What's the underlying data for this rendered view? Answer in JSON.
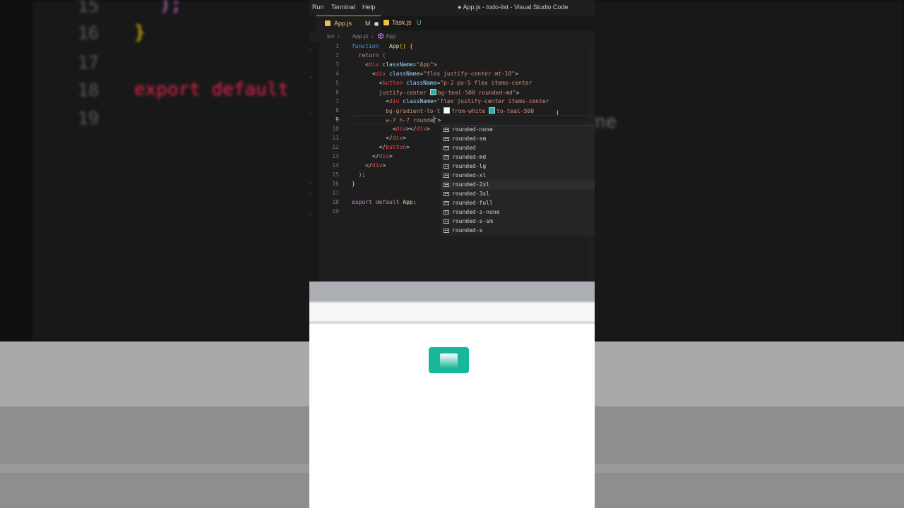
{
  "window": {
    "title": "● App.js - todo-list - Visual Studio Code"
  },
  "menu": [
    "Run",
    "Terminal",
    "Help"
  ],
  "tabs": [
    {
      "label": "App.js",
      "badge": "M",
      "dirty": true,
      "active": true
    },
    {
      "label": "Task.js",
      "badge": "U",
      "dirty": false,
      "active": false
    }
  ],
  "breadcrumb": {
    "folder": "src",
    "sep": "›",
    "file": "App.js",
    "symbol": "App"
  },
  "editor": {
    "line_numbers": [
      "1",
      "2",
      "3",
      "4",
      "5",
      "6",
      "7",
      "8",
      "9",
      "10",
      "11",
      "12",
      "13",
      "14",
      "15",
      "16",
      "17",
      "18",
      "19"
    ],
    "current_line": "9",
    "swatch_colors": {
      "white": "#ffffff",
      "teal500": "#14b8a6"
    }
  },
  "suggestions": {
    "items": [
      "rounded-none",
      "rounded-sm",
      "rounded",
      "rounded-md",
      "rounded-lg",
      "rounded-xl",
      "rounded-2xl",
      "rounded-3xl",
      "rounded-full",
      "rounded-s-none",
      "rounded-s-sm",
      "rounded-s"
    ],
    "selected_index": 6
  },
  "background_blur": {
    "line_numbers": [
      "15",
      "16",
      "17",
      "18",
      "19"
    ],
    "code_line_15": ");",
    "code_line_16": "}",
    "code_line_18": "export default",
    "right_fragment": "ne"
  },
  "colors": {
    "teal_button": "#19b79a",
    "gradient_from": "#ffffff",
    "gradient_to": "#19b79a",
    "editor_bg": "#1e1e1e"
  }
}
